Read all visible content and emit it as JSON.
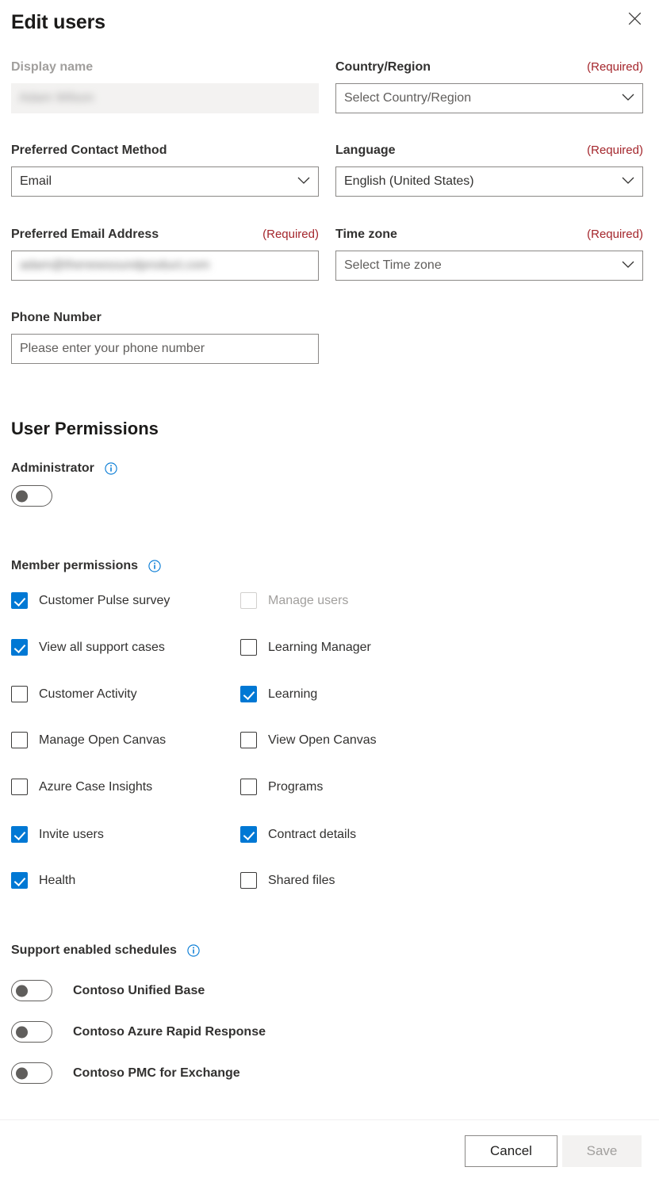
{
  "header": {
    "title": "Edit users",
    "close_label": "Close"
  },
  "form": {
    "display_name": {
      "label": "Display name",
      "value": "Adam Wilson",
      "disabled": true
    },
    "country_region": {
      "label": "Country/Region",
      "required_tag": "(Required)",
      "placeholder": "Select Country/Region"
    },
    "preferred_contact_method": {
      "label": "Preferred Contact Method",
      "value": "Email"
    },
    "language": {
      "label": "Language",
      "required_tag": "(Required)",
      "value": "English (United States)"
    },
    "preferred_email_address": {
      "label": "Preferred Email Address",
      "required_tag": "(Required)",
      "value": "adam@thenewsoundproduct.com"
    },
    "time_zone": {
      "label": "Time zone",
      "required_tag": "(Required)",
      "placeholder": "Select Time zone"
    },
    "phone_number": {
      "label": "Phone Number",
      "placeholder": "Please enter your phone number",
      "value": ""
    }
  },
  "permissions": {
    "section_title": "User Permissions",
    "administrator": {
      "label": "Administrator",
      "info_icon": "info-icon",
      "enabled": false
    },
    "member_permissions": {
      "label": "Member permissions",
      "info_icon": "info-icon",
      "left_column": [
        {
          "label": "Customer Pulse survey",
          "checked": true,
          "disabled": false
        },
        {
          "label": "View all support cases",
          "checked": true,
          "disabled": false
        },
        {
          "label": "Customer Activity",
          "checked": false,
          "disabled": false
        },
        {
          "label": "Manage Open Canvas",
          "checked": false,
          "disabled": false
        },
        {
          "label": "Azure Case Insights",
          "checked": false,
          "disabled": false
        },
        {
          "label": "Invite users",
          "checked": true,
          "disabled": false
        },
        {
          "label": "Health",
          "checked": true,
          "disabled": false
        }
      ],
      "right_column": [
        {
          "label": "Manage users",
          "checked": false,
          "disabled": true
        },
        {
          "label": "Learning Manager",
          "checked": false,
          "disabled": false
        },
        {
          "label": "Learning",
          "checked": true,
          "disabled": false
        },
        {
          "label": "View Open Canvas",
          "checked": false,
          "disabled": false
        },
        {
          "label": "Programs",
          "checked": false,
          "disabled": false
        },
        {
          "label": "Contract details",
          "checked": true,
          "disabled": false
        },
        {
          "label": "Shared files",
          "checked": false,
          "disabled": false
        }
      ]
    }
  },
  "schedules": {
    "label": "Support enabled schedules",
    "info_icon": "info-icon",
    "items": [
      {
        "label": "Contoso Unified Base",
        "enabled": false
      },
      {
        "label": "Contoso Azure Rapid Response",
        "enabled": false
      },
      {
        "label": "Contoso PMC for Exchange",
        "enabled": false
      }
    ]
  },
  "footer": {
    "cancel_label": "Cancel",
    "save_label": "Save",
    "save_disabled": true
  },
  "colors": {
    "accent": "#0078d4",
    "required_red": "#a4262c",
    "text_primary": "#323130",
    "text_disabled": "#a19f9d",
    "border": "#8a8886",
    "disabled_bg": "#f3f2f1"
  }
}
